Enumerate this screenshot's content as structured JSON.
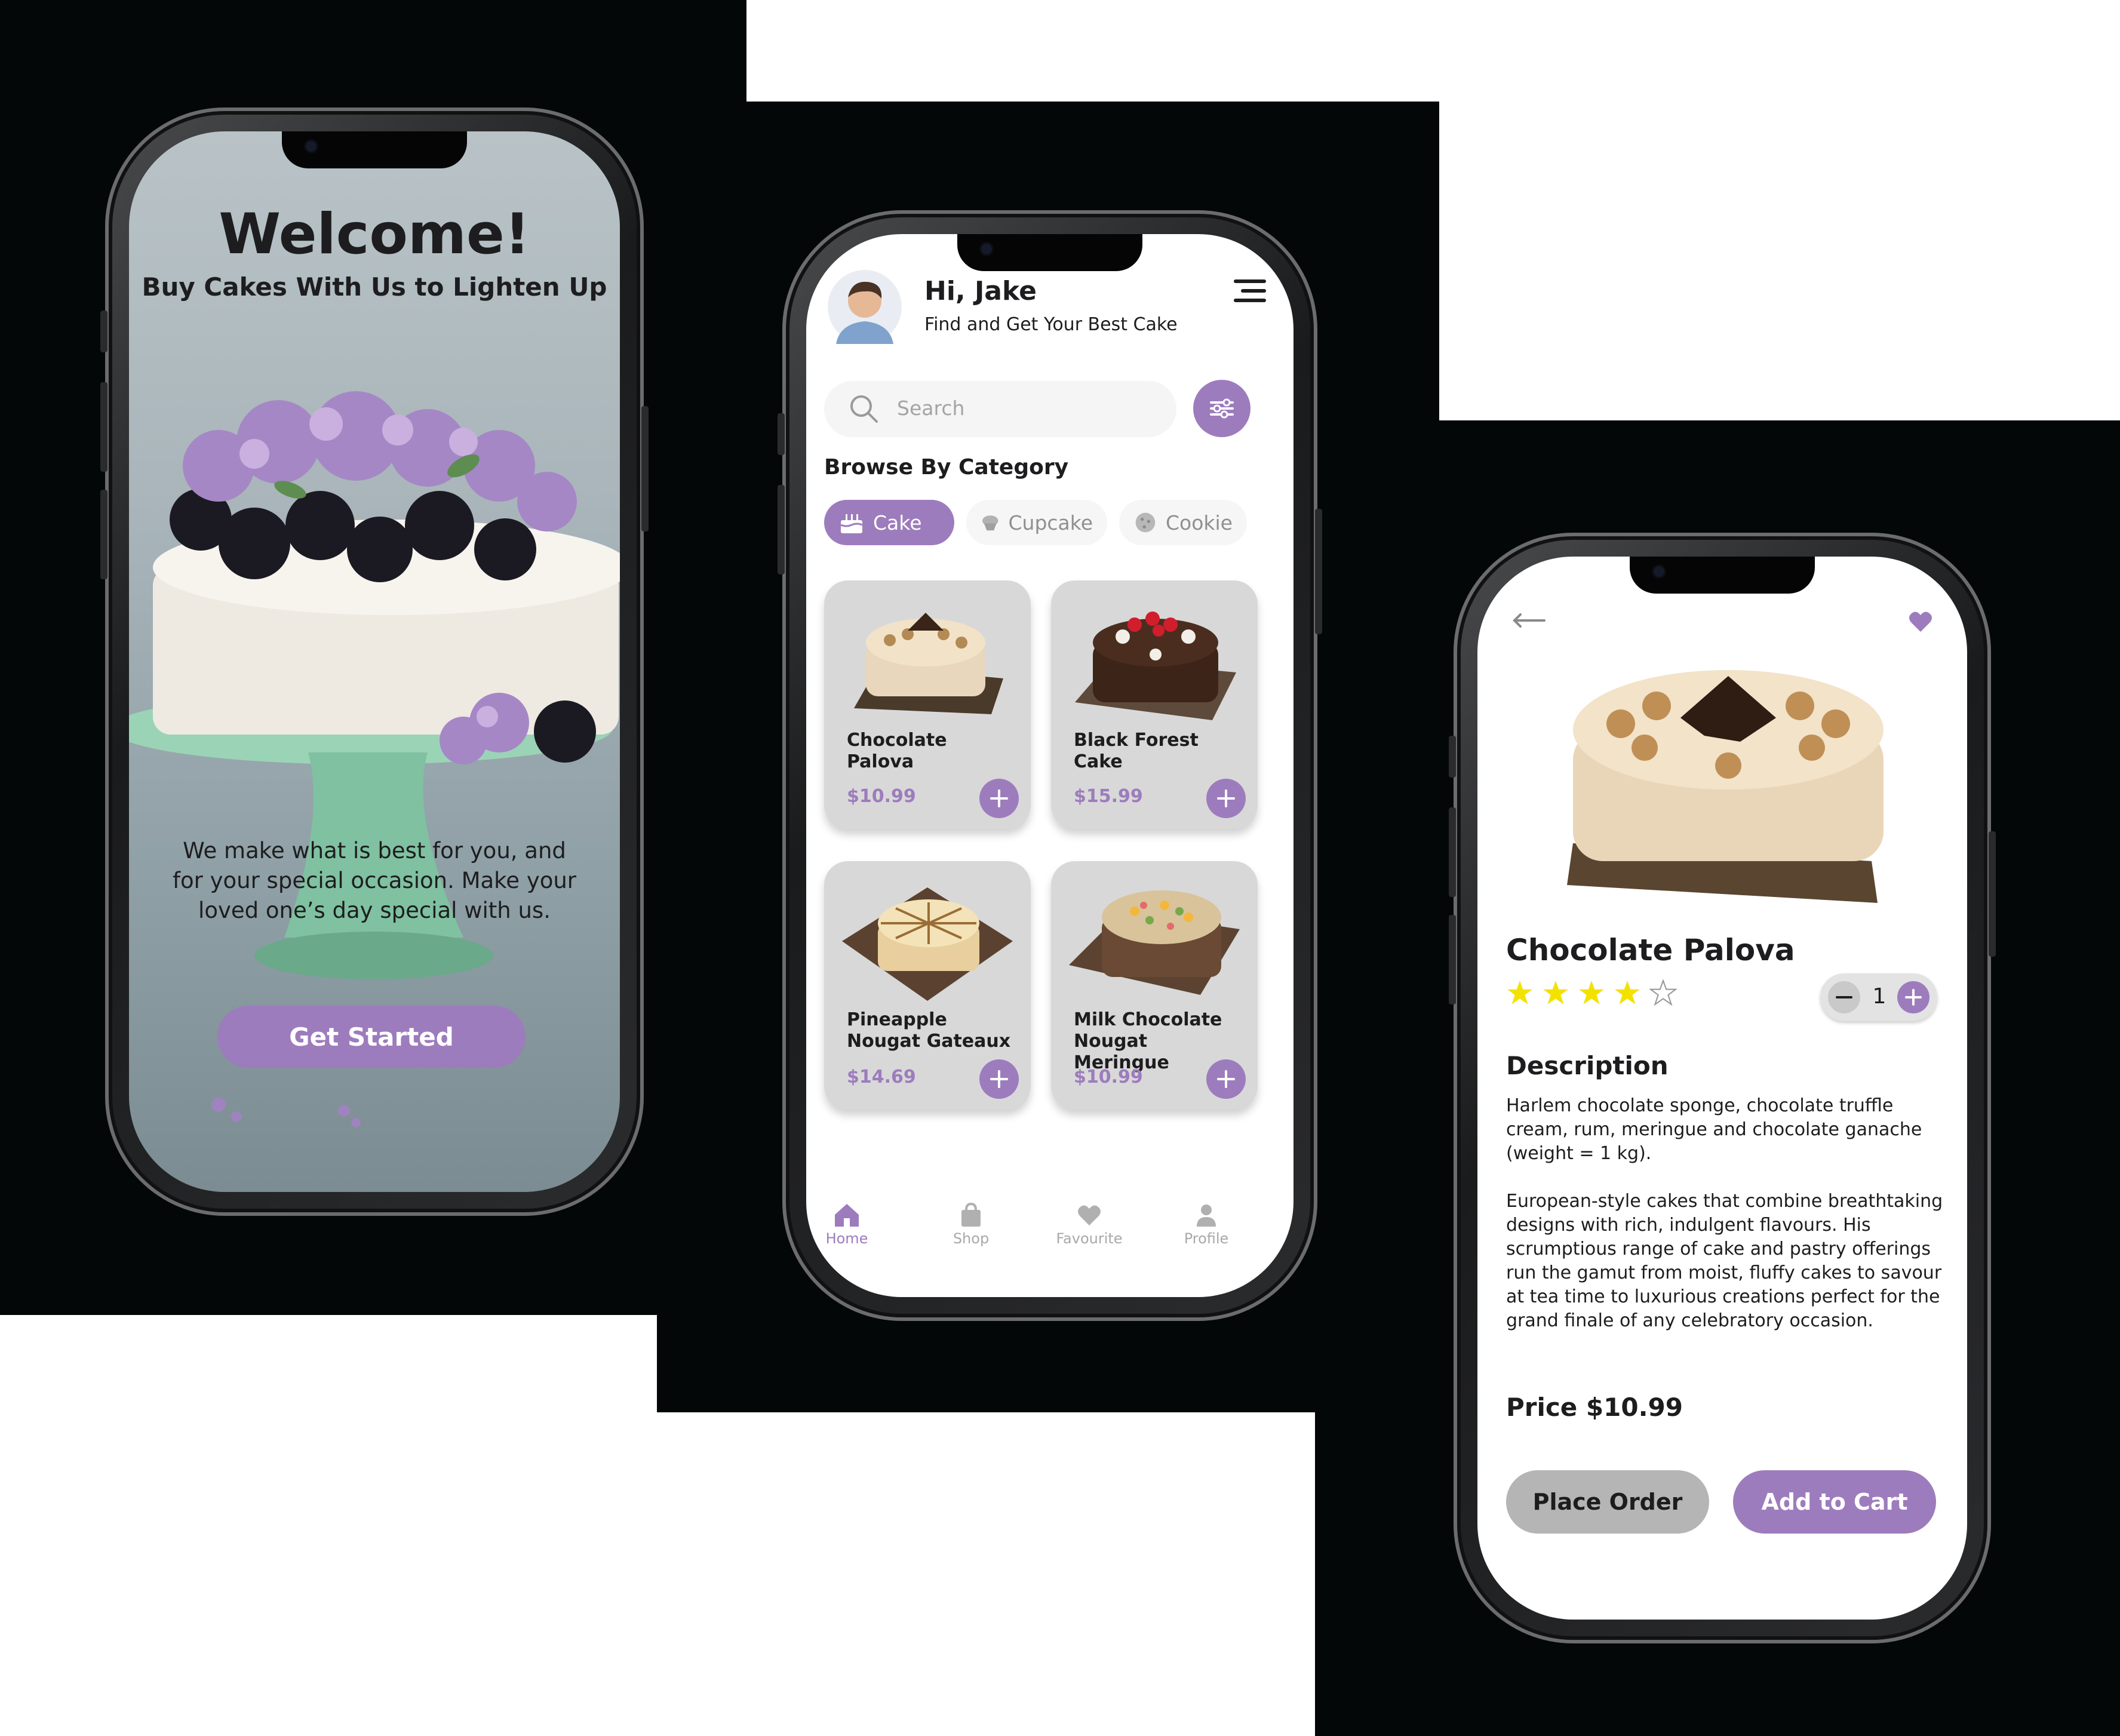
{
  "colors": {
    "accent": "#9d7cbd",
    "text": "#1d1d1f",
    "muted": "#a9a9a9",
    "star": "#f3e200"
  },
  "welcome": {
    "title": "Welcome!",
    "subtitle": "Buy Cakes With Us to Lighten Up",
    "body": "We make what is best for you, and for your special occasion. Make your loved one’s day special with us.",
    "cta": "Get Started"
  },
  "home": {
    "greeting": "Hi, Jake",
    "tagline": "Find and Get Your Best Cake",
    "search_placeholder": "Search",
    "section_title": "Browse By Category",
    "categories": [
      {
        "label": "Cake",
        "icon": "cake-icon",
        "active": true
      },
      {
        "label": "Cupcake",
        "icon": "cupcake-icon",
        "active": false
      },
      {
        "label": "Cookie",
        "icon": "cookie-icon",
        "active": false
      }
    ],
    "products": [
      {
        "name": "Chocolate Palova",
        "price": "$10.99"
      },
      {
        "name": "Black Forest Cake",
        "price": "$15.99"
      },
      {
        "name": "Pineapple Nougat Gateaux",
        "price": "$14.69"
      },
      {
        "name": "Milk Chocolate Nougat Meringue",
        "price": "$10.99"
      }
    ],
    "nav": [
      {
        "label": "Home",
        "icon": "home-icon",
        "active": true
      },
      {
        "label": "Shop",
        "icon": "shopping-bag-icon",
        "active": false
      },
      {
        "label": "Favourite",
        "icon": "heart-icon",
        "active": false
      },
      {
        "label": "Profile",
        "icon": "user-icon",
        "active": false
      }
    ]
  },
  "detail": {
    "title": "Chocolate Palova",
    "rating": 4,
    "rating_max": 5,
    "quantity": "1",
    "description_title": "Description",
    "description_1": "Harlem chocolate sponge, chocolate truffle cream, rum, meringue and chocolate ganache (weight = 1 kg).",
    "description_2": "European-style cakes that combine breathtaking designs with rich, indulgent flavours. His scrumptious range of cake and pastry offerings run the gamut from moist, fluffy cakes to savour at tea time to luxurious creations perfect for the grand finale of any celebratory occasion.",
    "price_label": "Price $10.99",
    "place_order": "Place Order",
    "add_to_cart": "Add to Cart"
  }
}
